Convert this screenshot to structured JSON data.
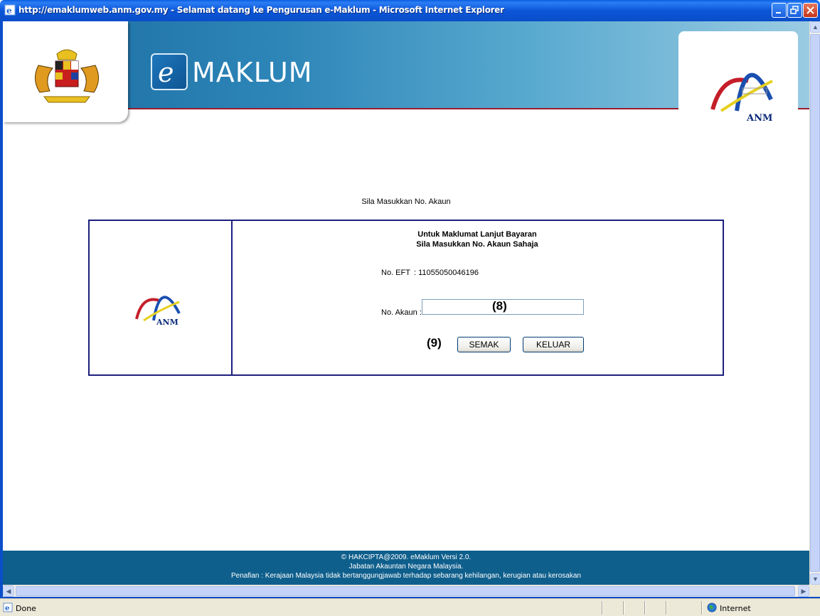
{
  "window": {
    "title": "http://emaklumweb.anm.gov.my - Selamat datang ke Pengurusan e-Maklum - Microsoft Internet Explorer"
  },
  "header": {
    "brand": "MAKLUM",
    "logo_text": "ANM"
  },
  "form": {
    "prompt": "Sila Masukkan No. Akaun",
    "heading_line1": "Untuk Maklumat Lanjut Bayaran",
    "heading_line2": "Sila Masukkan No. Akaun Sahaja",
    "eft_label": "No. EFT",
    "eft_value": ": 11055050046196",
    "akaun_label": "No. Akaun :",
    "akaun_value": "",
    "annotation_input": "(8)",
    "annotation_button": "(9)",
    "semak_label": "SEMAK",
    "keluar_label": "KELUAR",
    "small_logo_text": "ANM"
  },
  "footer": {
    "line1": "© HAKCIPTA@2009. eMaklum Versi 2.0.",
    "line2": "Jabatan Akauntan Negara Malaysia.",
    "line3": "Penafian : Kerajaan Malaysia tidak bertanggungjawab terhadap sebarang kehilangan, kerugian atau kerosakan"
  },
  "statusbar": {
    "status": "Done",
    "zone": "Internet"
  },
  "colors": {
    "header_blue": "#1a6ba0",
    "footer_blue": "#0f5f8c",
    "box_border": "#1c1f7d",
    "accent_red": "#9a1b2b"
  }
}
